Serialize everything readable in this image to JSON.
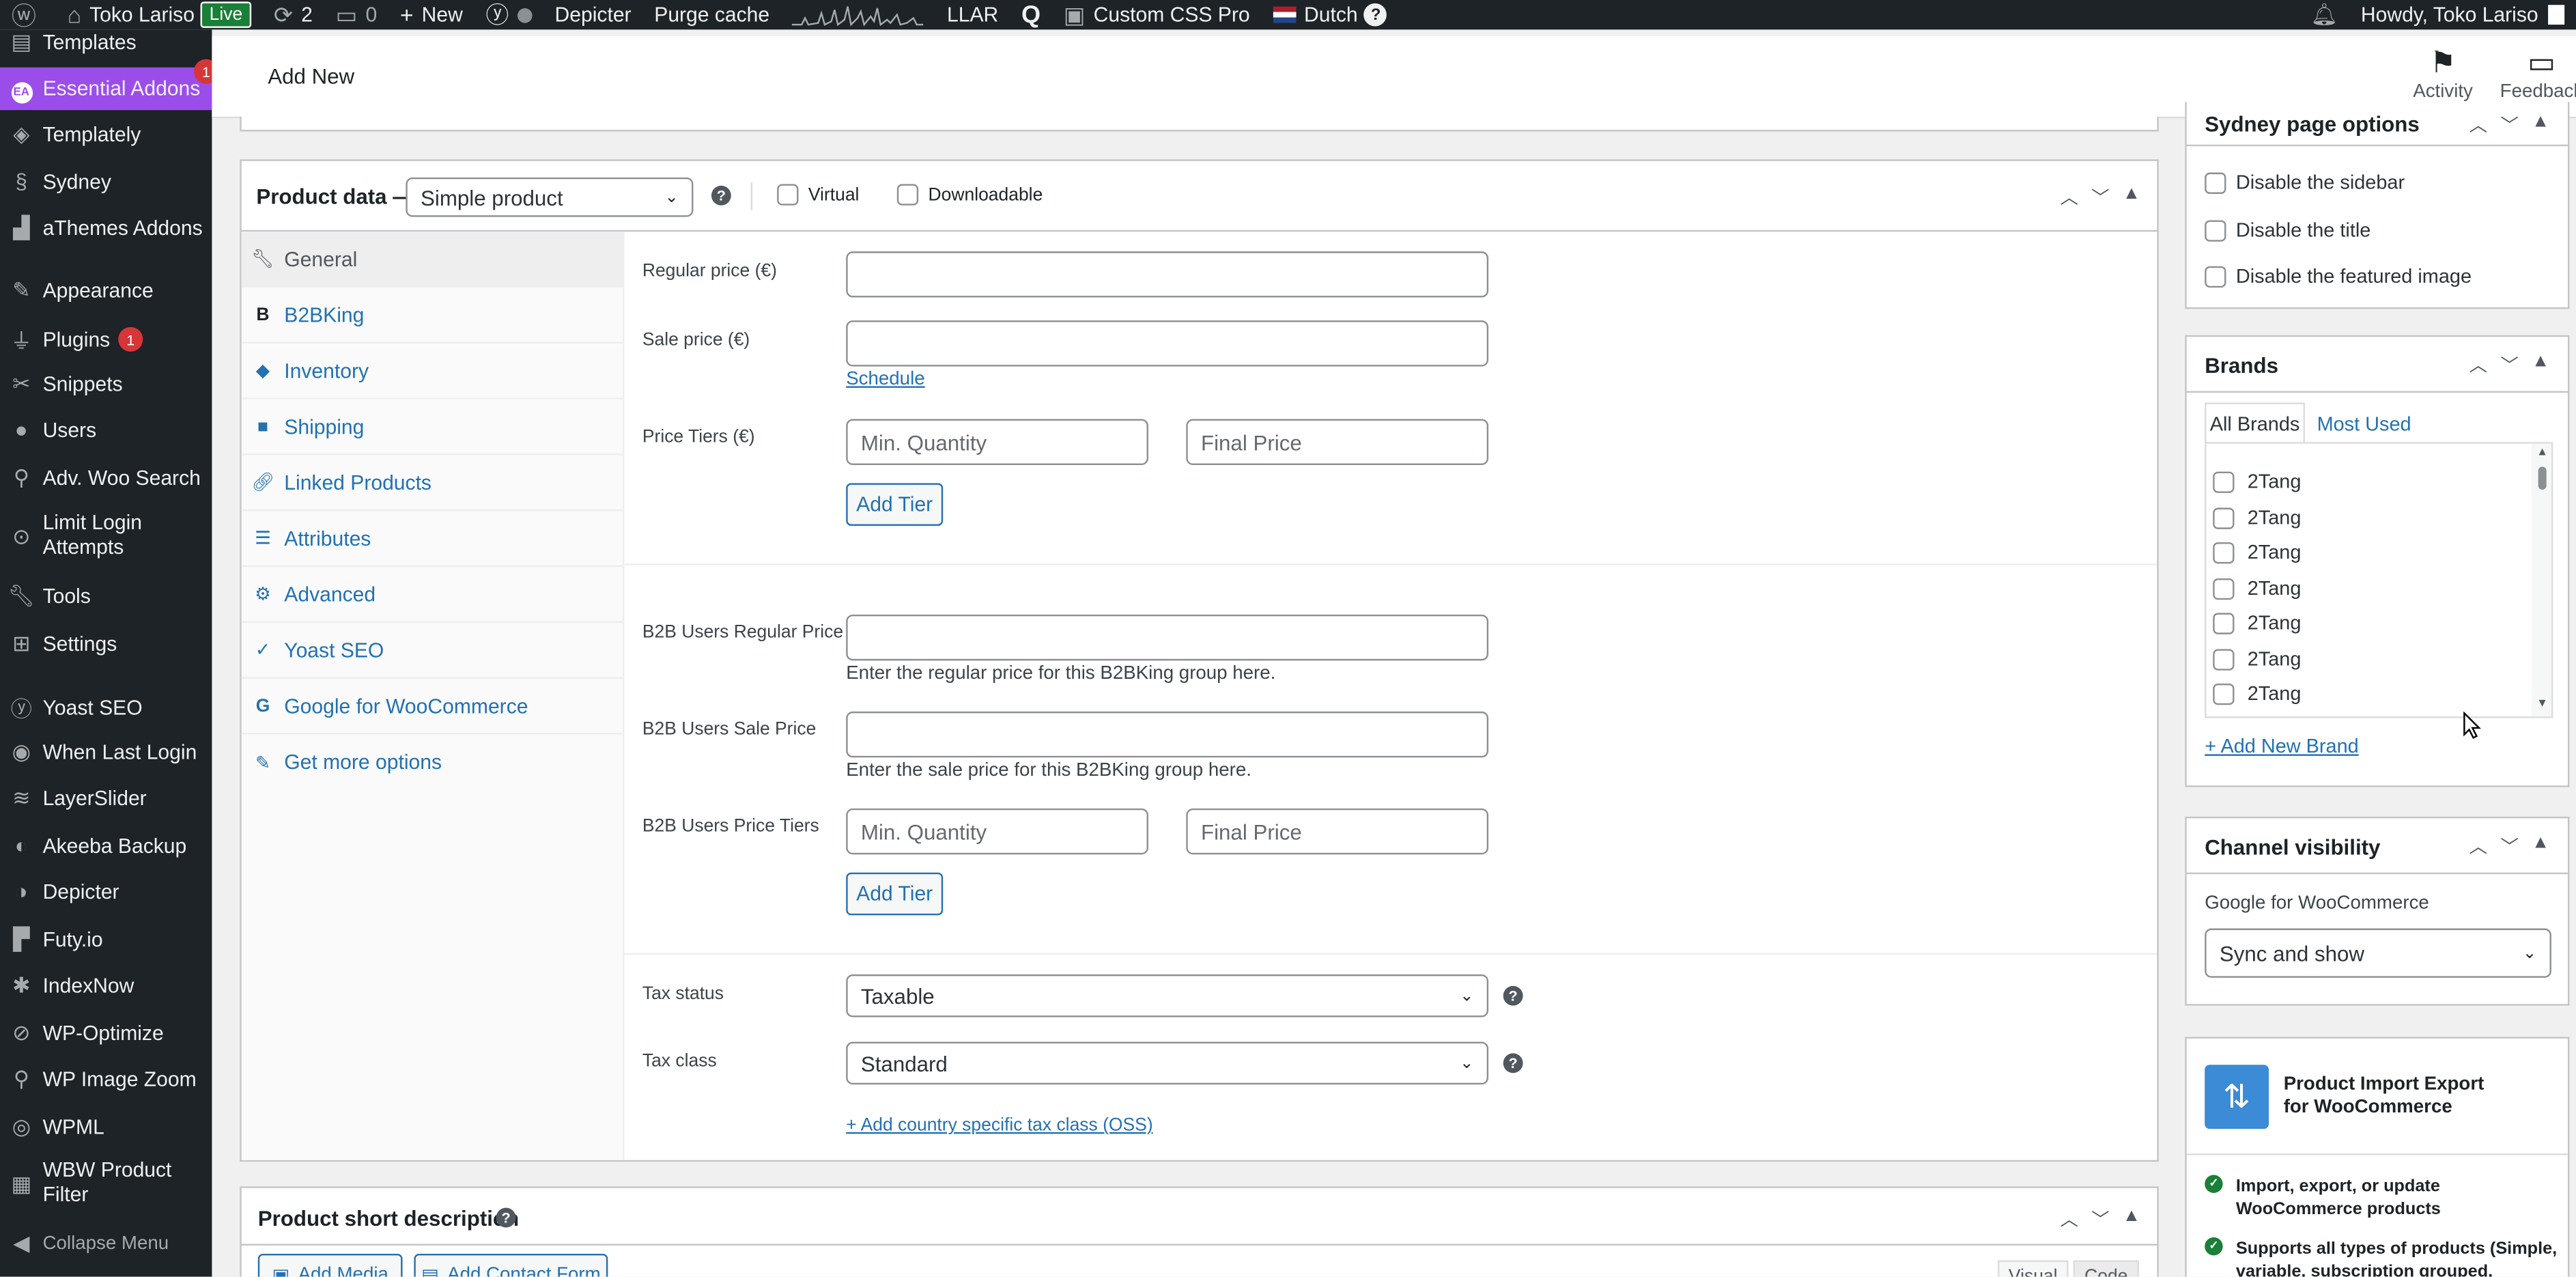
{
  "admin_bar": {
    "site_name": "Toko Lariso",
    "live_badge": "Live",
    "updates_count": "2",
    "comments_count": "0",
    "new_label": "New",
    "depicter_label": "Depicter",
    "purge_cache_label": "Purge cache",
    "llar_label": "LLAR",
    "custom_css_label": "Custom CSS Pro",
    "language_label": "Dutch",
    "greeting": "Howdy, Toko Lariso"
  },
  "sidebar": {
    "items": [
      {
        "label": "Templates",
        "icon": "templates-icon"
      },
      {
        "label": "Essential Addons",
        "icon": "ea-icon",
        "badge": "1"
      },
      {
        "label": "Templately",
        "icon": "templately-icon"
      },
      {
        "label": "Sydney",
        "icon": "sydney-icon"
      },
      {
        "label": "aThemes Addons",
        "icon": "athemes-icon"
      },
      {
        "label": "Appearance",
        "icon": "brush-icon"
      },
      {
        "label": "Plugins",
        "icon": "plugin-icon",
        "badge": "1"
      },
      {
        "label": "Snippets",
        "icon": "snippets-icon"
      },
      {
        "label": "Users",
        "icon": "users-icon"
      },
      {
        "label": "Adv. Woo Search",
        "icon": "search-icon"
      },
      {
        "label": "Limit Login Attempts",
        "icon": "limit-login-icon"
      },
      {
        "label": "Tools",
        "icon": "tools-icon"
      },
      {
        "label": "Settings",
        "icon": "settings-icon"
      },
      {
        "label": "Yoast SEO",
        "icon": "yoast-icon"
      },
      {
        "label": "When Last Login",
        "icon": "eye-icon"
      },
      {
        "label": "LayerSlider",
        "icon": "layers-icon"
      },
      {
        "label": "Akeeba Backup",
        "icon": "akeeba-icon"
      },
      {
        "label": "Depicter",
        "icon": "depicter-icon"
      },
      {
        "label": "Futy.io",
        "icon": "futy-icon"
      },
      {
        "label": "IndexNow",
        "icon": "indexnow-icon"
      },
      {
        "label": "WP-Optimize",
        "icon": "wpoptimize-icon"
      },
      {
        "label": "WP Image Zoom",
        "icon": "zoom-icon"
      },
      {
        "label": "WPML",
        "icon": "wpml-icon"
      },
      {
        "label": "WBW Product Filter",
        "icon": "filter-icon"
      },
      {
        "label": "Collapse Menu",
        "icon": "collapse-icon"
      }
    ]
  },
  "header": {
    "title": "Add New",
    "activity_label": "Activity",
    "feedback_label": "Feedback"
  },
  "product_data": {
    "title": "Product data —",
    "type_select": "Simple product",
    "virtual_label": "Virtual",
    "downloadable_label": "Downloadable",
    "tabs": [
      {
        "label": "General",
        "icon": "wrench-icon"
      },
      {
        "label": "B2BKing",
        "icon": "b2bking-icon"
      },
      {
        "label": "Inventory",
        "icon": "tag-icon"
      },
      {
        "label": "Shipping",
        "icon": "truck-icon"
      },
      {
        "label": "Linked Products",
        "icon": "link-icon"
      },
      {
        "label": "Attributes",
        "icon": "list-icon"
      },
      {
        "label": "Advanced",
        "icon": "gear-icon"
      },
      {
        "label": "Yoast SEO",
        "icon": "yoast-icon"
      },
      {
        "label": "Google for WooCommerce",
        "icon": "google-icon"
      },
      {
        "label": "Get more options",
        "icon": "plug-icon"
      }
    ],
    "regular_price_label": "Regular price (€)",
    "sale_price_label": "Sale price (€)",
    "schedule_link": "Schedule",
    "price_tiers_label": "Price Tiers (€)",
    "min_quantity_placeholder": "Min. Quantity",
    "final_price_placeholder": "Final Price",
    "add_tier_label": "Add Tier",
    "b2b_regular_label": "B2B Users Regular Price",
    "b2b_regular_hint": "Enter the regular price for this B2BKing group here.",
    "b2b_sale_label": "B2B Users Sale Price",
    "b2b_sale_hint": "Enter the sale price for this B2BKing group here.",
    "b2b_tiers_label": "B2B Users Price Tiers",
    "tax_status_label": "Tax status",
    "tax_status_value": "Taxable",
    "tax_class_label": "Tax class",
    "tax_class_value": "Standard",
    "oss_link": "+ Add country specific tax class (OSS)"
  },
  "short_description": {
    "title": "Product short description",
    "add_media": "Add Media",
    "add_contact_form": "Add Contact Form",
    "visual_tab": "Visual",
    "code_tab": "Code"
  },
  "sydney_options": {
    "title": "Sydney page options",
    "options": [
      "Disable the sidebar",
      "Disable the title",
      "Disable the featured image"
    ]
  },
  "brands": {
    "title": "Brands",
    "tab_all": "All Brands",
    "tab_most_used": "Most Used",
    "items": [
      "2Tang",
      "2Tang",
      "2Tang",
      "2Tang",
      "2Tang",
      "2Tang",
      "2Tang"
    ],
    "add_new": "+ Add New Brand"
  },
  "channel_visibility": {
    "title": "Channel visibility",
    "label": "Google for WooCommerce",
    "value": "Sync and show"
  },
  "import_export": {
    "title": "Product Import Export for WooCommerce",
    "features": [
      "Import, export, or update WooCommerce products",
      "Supports all types of products (Simple, variable, subscription grouped,"
    ]
  },
  "colors": {
    "admin_bar_bg": "#1d2327",
    "sidebar_active": "#9b4dea",
    "link": "#2271b1",
    "badge": "#d63638"
  }
}
